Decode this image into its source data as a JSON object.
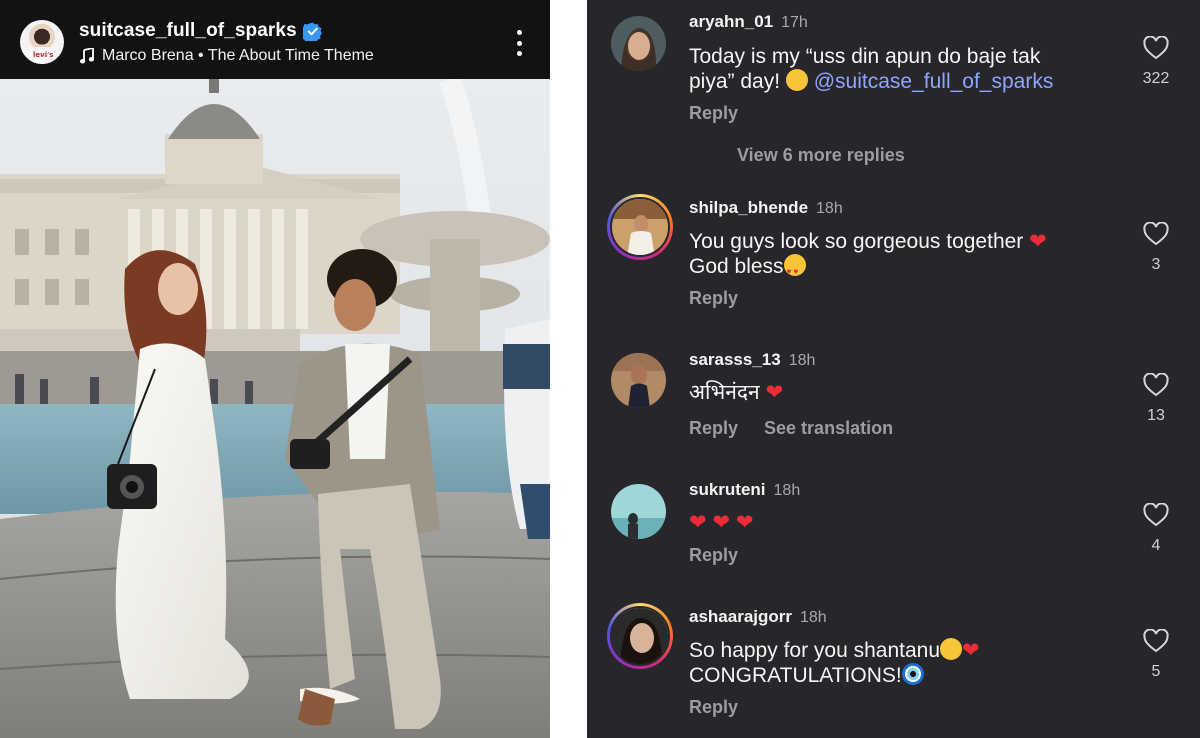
{
  "post": {
    "username": "suitcase_full_of_sparks",
    "music": "Marco Brena • The About Time Theme",
    "avatar_shirt_text": "levi's",
    "colors": {
      "header_bg": "#121212",
      "verified": "#3897f0"
    }
  },
  "comments": {
    "view_more": "View 6 more replies",
    "reply_label": "Reply",
    "translate_label": "See translation",
    "colors": {
      "panel_bg": "#26262b",
      "mention": "#8fa6ff",
      "heart_red": "#ed2c38"
    },
    "items": [
      {
        "user": "aryahn_01",
        "time": "17h",
        "text_line1": "Today is my “uss din apun do baje tak",
        "text_line2_pre": "piya” day! ",
        "mention": "@suitcase_full_of_sparks",
        "likes": "322"
      },
      {
        "user": "shilpa_bhende",
        "time": "18h",
        "text_line1": "You guys look so gorgeous together",
        "text_line2": "God bless",
        "likes": "3"
      },
      {
        "user": "sarasss_13",
        "time": "18h",
        "text_line1": "अभिनंदन",
        "likes": "13"
      },
      {
        "user": "sukruteni",
        "time": "18h",
        "text_line1": "",
        "likes": "4"
      },
      {
        "user": "ashaarajgorr",
        "time": "18h",
        "text_line1": "So happy for you shantanu",
        "text_line2": "CONGRATULATIONS!",
        "likes": "5"
      }
    ]
  }
}
